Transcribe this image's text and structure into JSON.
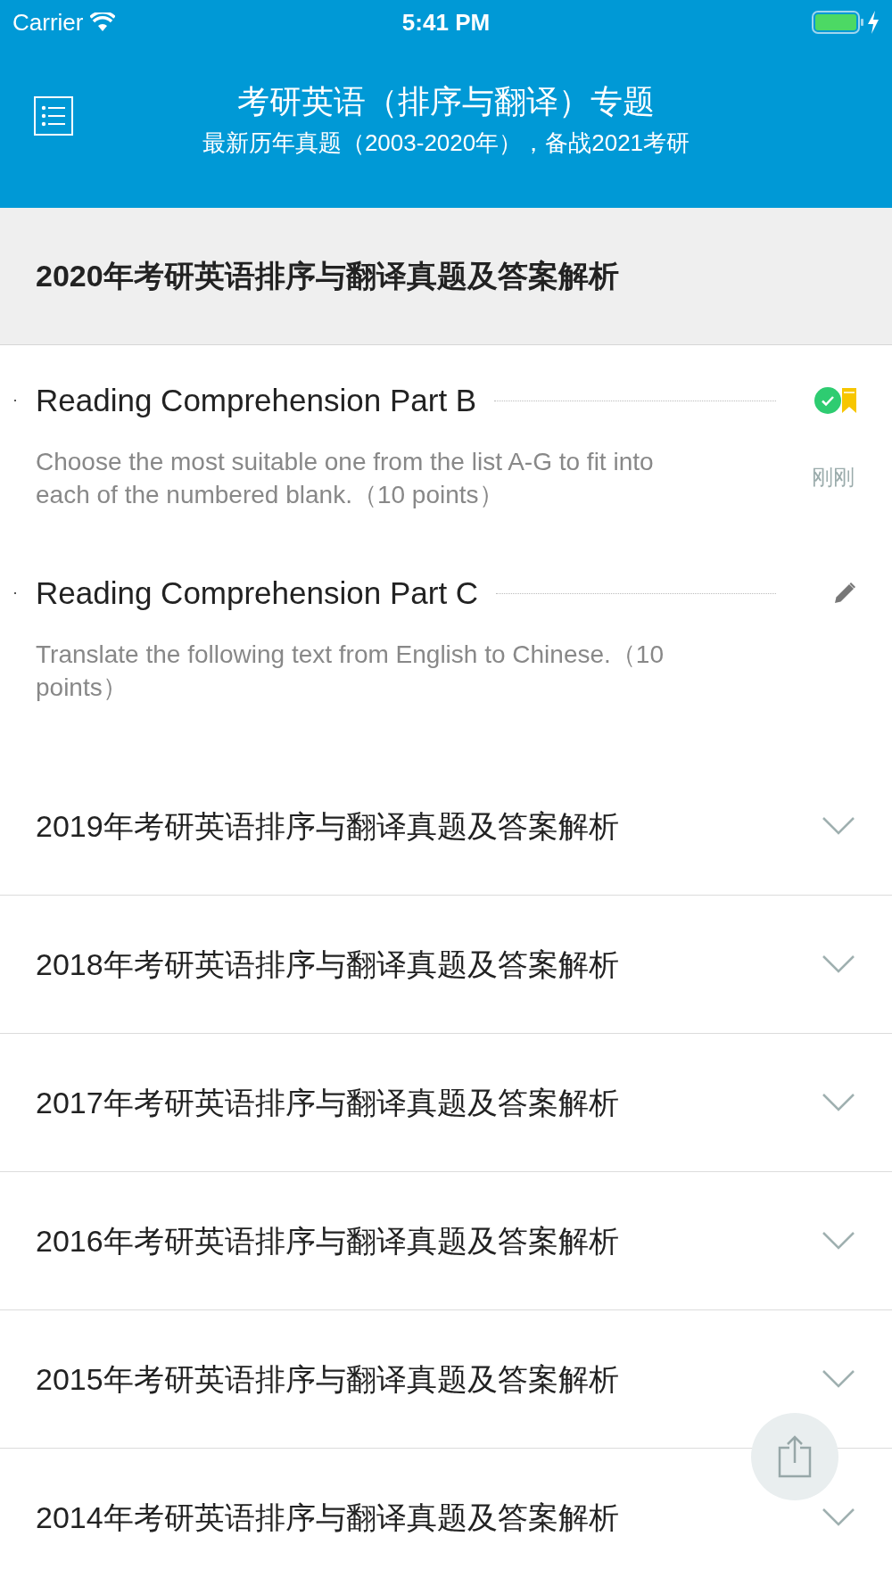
{
  "status_bar": {
    "carrier": "Carrier",
    "time": "5:41 PM"
  },
  "header": {
    "title": "考研英语（排序与翻译）专题",
    "subtitle": "最新历年真题（2003-2020年），备战2021考研"
  },
  "sections": [
    {
      "title": "2020年考研英语排序与翻译真题及答案解析",
      "expanded": true,
      "items": [
        {
          "kind": "done",
          "title": "Reading Comprehension Part B",
          "description": "Choose the most suitable one from the list A-G to fit into each of the numbered blank.（10 points）",
          "time": "刚刚"
        },
        {
          "kind": "editing",
          "title": "Reading Comprehension Part C",
          "description": "Translate the following text from English to Chinese.（10 points）"
        }
      ]
    },
    {
      "title": "2019年考研英语排序与翻译真题及答案解析",
      "expanded": false
    },
    {
      "title": "2018年考研英语排序与翻译真题及答案解析",
      "expanded": false
    },
    {
      "title": "2017年考研英语排序与翻译真题及答案解析",
      "expanded": false
    },
    {
      "title": "2016年考研英语排序与翻译真题及答案解析",
      "expanded": false
    },
    {
      "title": "2015年考研英语排序与翻译真题及答案解析",
      "expanded": false
    },
    {
      "title": "2014年考研英语排序与翻译真题及答案解析",
      "expanded": false
    }
  ]
}
